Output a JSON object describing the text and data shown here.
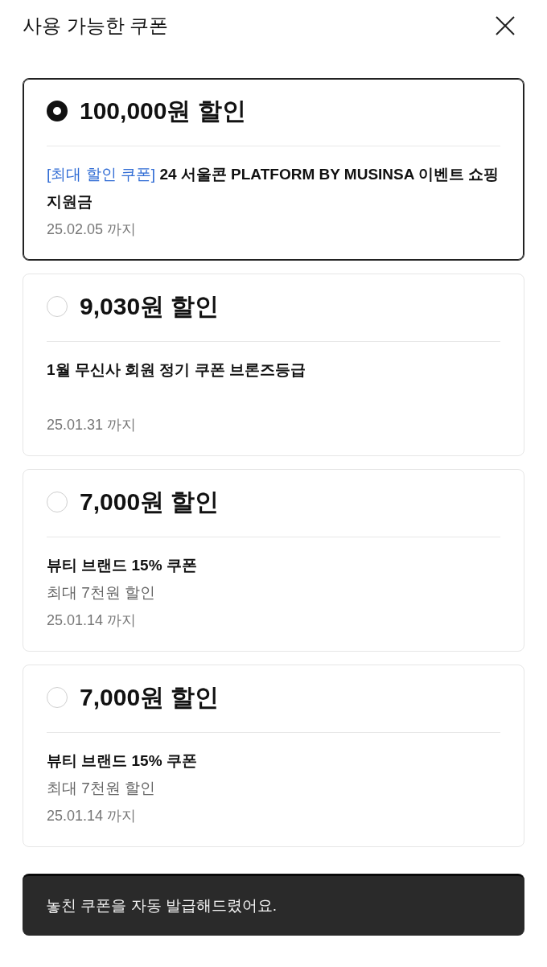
{
  "header": {
    "title": "사용 가능한 쿠폰"
  },
  "coupons": [
    {
      "selected": true,
      "amount": "100,000원 할인",
      "tag": "[최대 할인 쿠폰]",
      "name": "24 서울콘 PLATFORM BY MUSINSA 이벤트 쇼핑지원금",
      "expiry": "25.02.05 까지"
    },
    {
      "selected": false,
      "amount": "9,030원 할인",
      "name": "1월 무신사 회원 정기 쿠폰 브론즈등급",
      "expiry": "25.01.31 까지"
    },
    {
      "selected": false,
      "amount": "7,000원 할인",
      "name": "뷰티 브랜드 15% 쿠폰",
      "note": "최대 7천원 할인",
      "expiry": "25.01.14 까지"
    },
    {
      "selected": false,
      "amount": "7,000원 할인",
      "name": "뷰티 브랜드 15% 쿠폰",
      "note": "최대 7천원 할인",
      "expiry": "25.01.14 까지"
    }
  ],
  "toast": {
    "message": "놓친 쿠폰을 자동 발급해드렸어요."
  }
}
